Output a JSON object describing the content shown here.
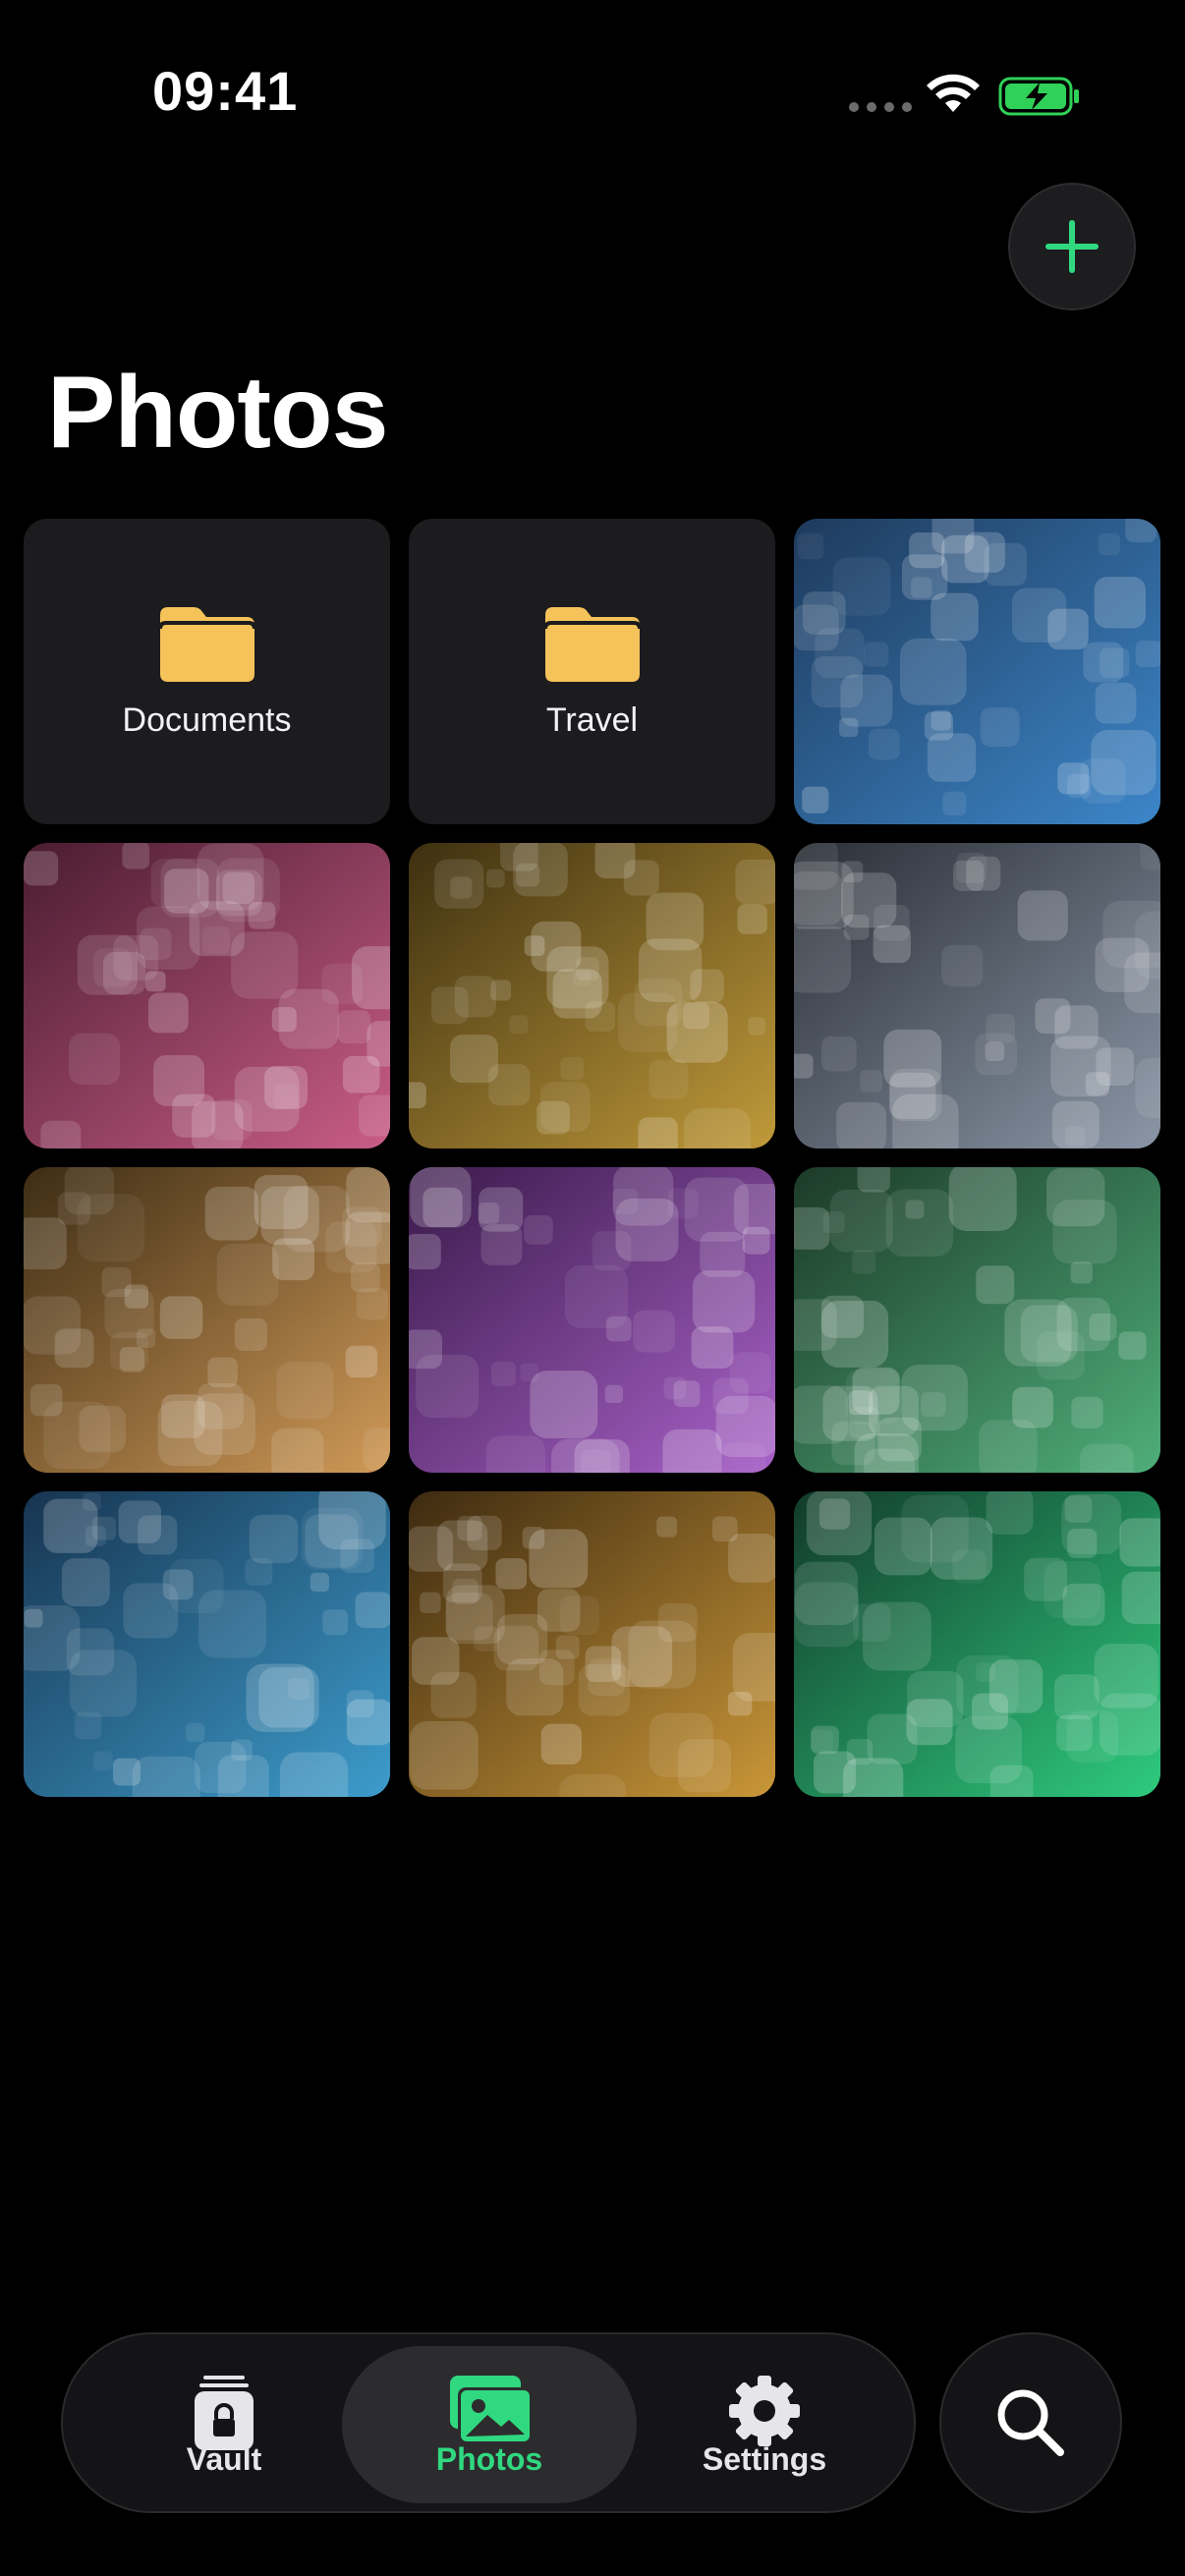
{
  "status_bar": {
    "time": "09:41"
  },
  "header": {
    "title": "Photos",
    "add_icon": "plus-icon"
  },
  "accent_color": "#30d980",
  "folders": [
    {
      "label": "Documents",
      "icon": "folder-icon"
    },
    {
      "label": "Travel",
      "icon": "folder-icon"
    }
  ],
  "photos": [
    {
      "name": "photo-blue",
      "colors": [
        "#1e3a5c",
        "#3d86c9"
      ]
    },
    {
      "name": "photo-pink",
      "colors": [
        "#4a1c30",
        "#c95d86"
      ]
    },
    {
      "name": "photo-olive",
      "colors": [
        "#3d2f10",
        "#c09a3a"
      ]
    },
    {
      "name": "photo-gray",
      "colors": [
        "#2a2e36",
        "#8a96a6"
      ]
    },
    {
      "name": "photo-amber",
      "colors": [
        "#3d2c14",
        "#d09a58"
      ]
    },
    {
      "name": "photo-purple",
      "colors": [
        "#3a1a4a",
        "#a962c9"
      ]
    },
    {
      "name": "photo-green",
      "colors": [
        "#1c3a28",
        "#4fae7a"
      ]
    },
    {
      "name": "photo-teal",
      "colors": [
        "#173450",
        "#3d9ccc"
      ]
    },
    {
      "name": "photo-gold",
      "colors": [
        "#3d2a10",
        "#c99638"
      ]
    },
    {
      "name": "photo-emerald",
      "colors": [
        "#123a2a",
        "#2ecb7e"
      ]
    }
  ],
  "tab_bar": {
    "tabs": [
      {
        "label": "Vault",
        "icon": "vault-lock-icon",
        "active": false
      },
      {
        "label": "Photos",
        "icon": "photos-icon",
        "active": true
      },
      {
        "label": "Settings",
        "icon": "gear-icon",
        "active": false
      }
    ],
    "search_icon": "search-icon"
  }
}
